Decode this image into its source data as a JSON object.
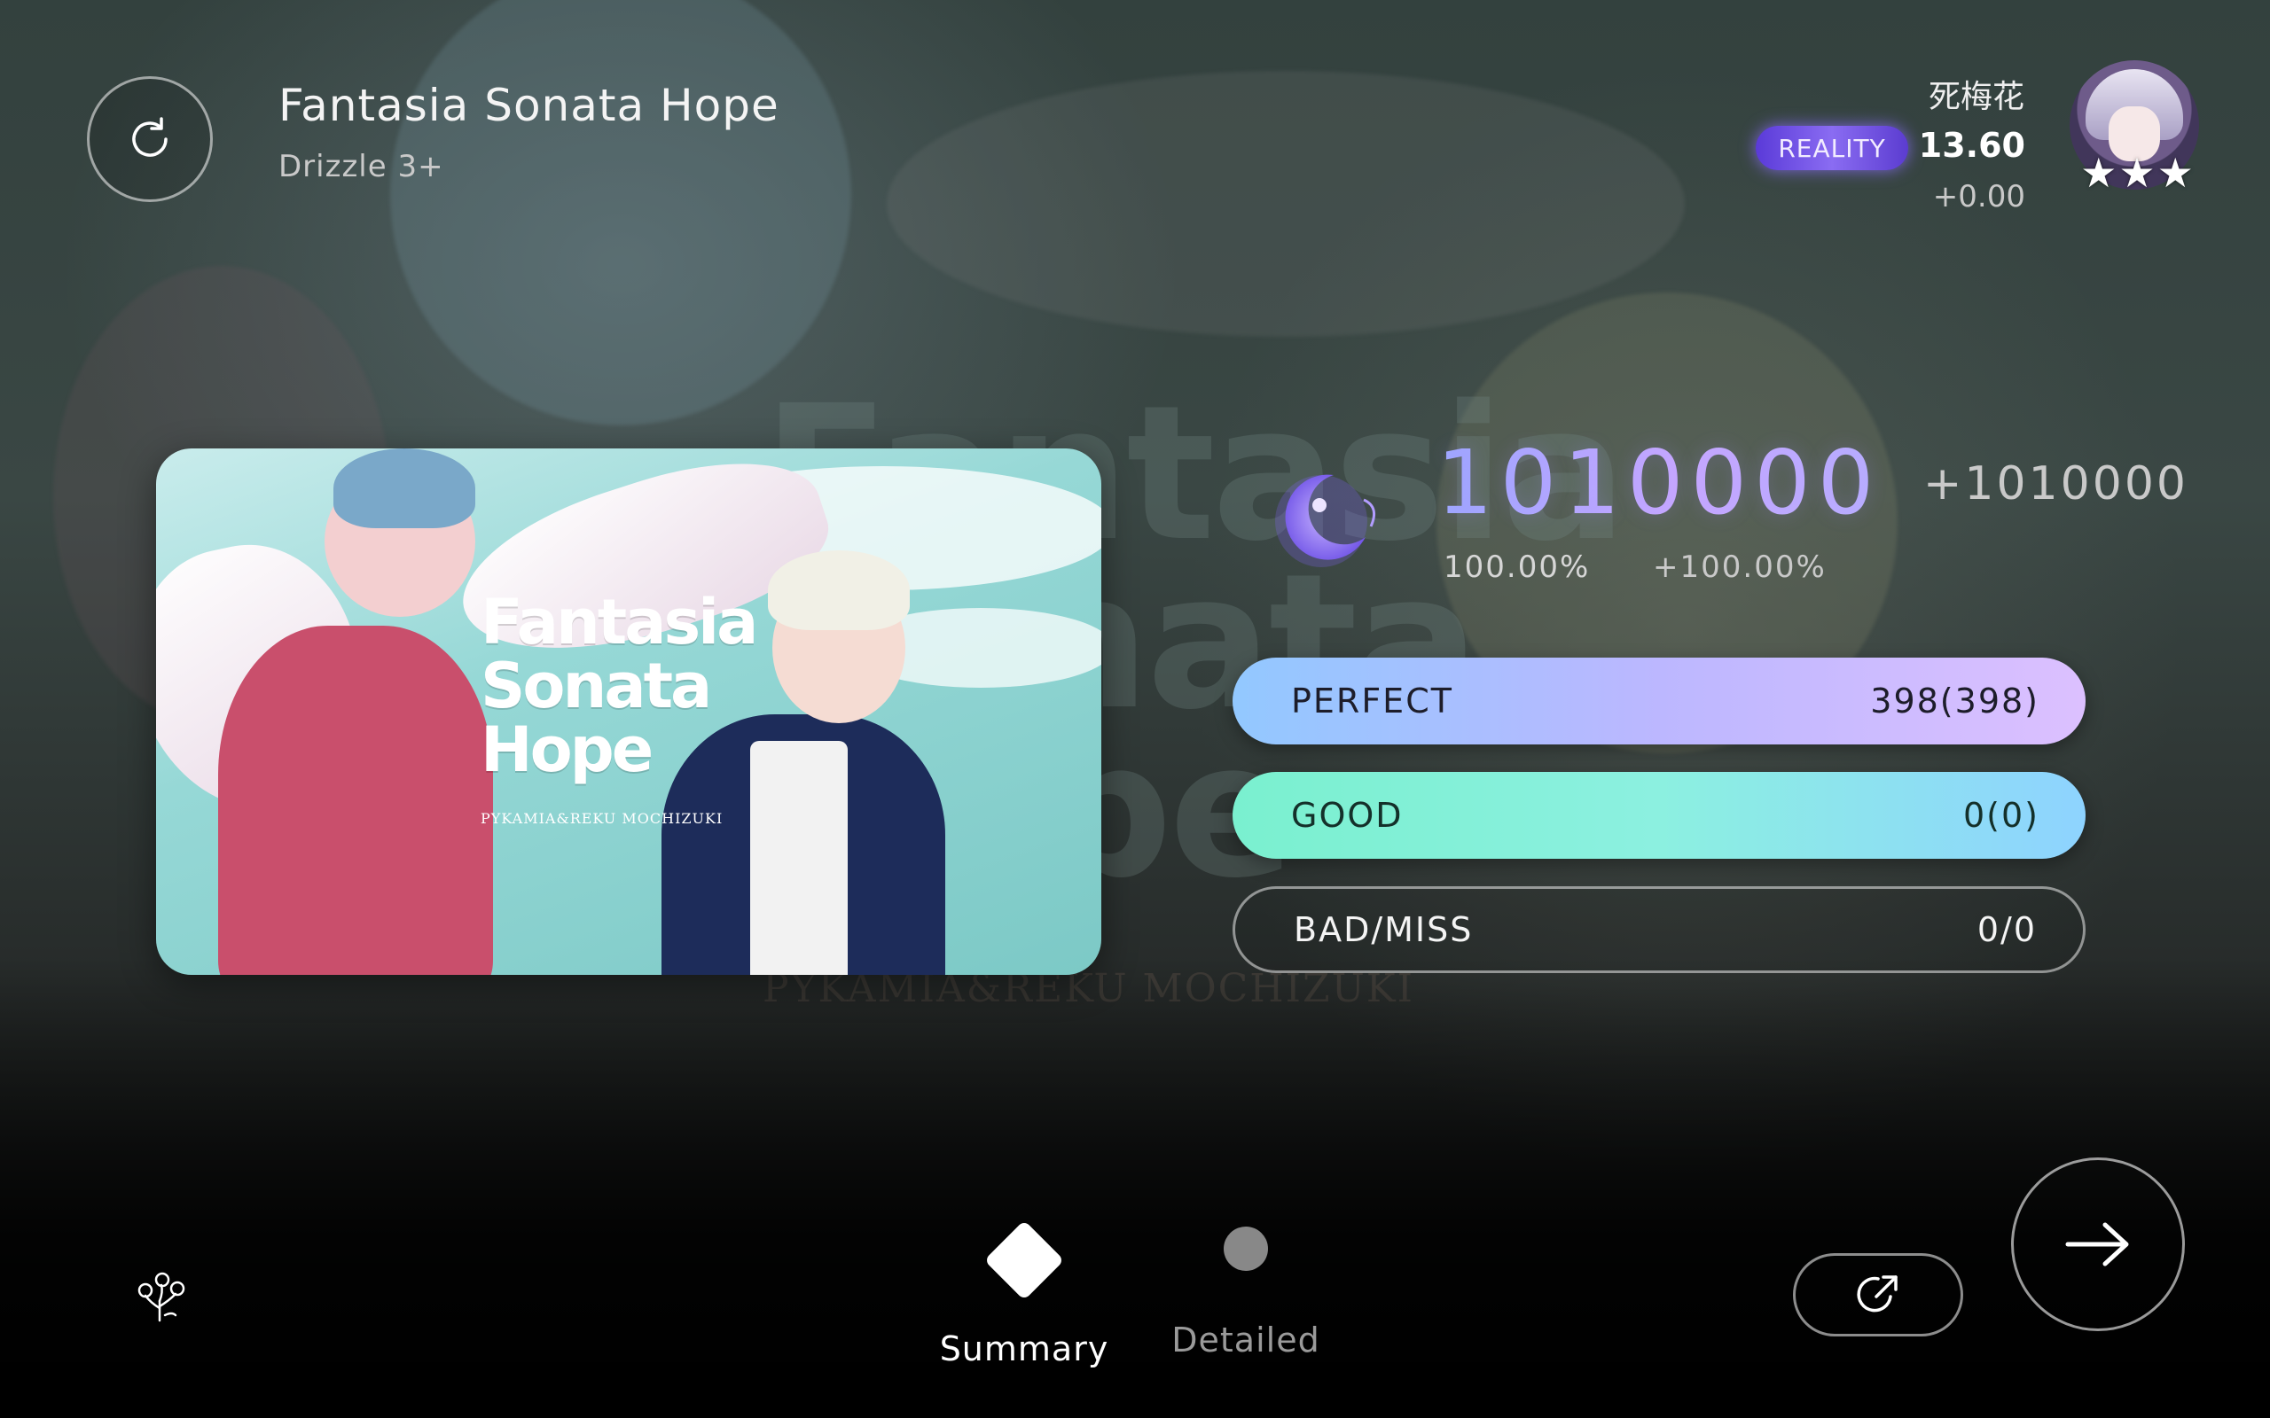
{
  "header": {
    "song_title": "Fantasia Sonata Hope",
    "difficulty": "Drizzle 3+"
  },
  "player": {
    "name": "死梅花",
    "badge": "REALITY",
    "rating": "13.60",
    "rating_delta": "+0.00",
    "stars": 3
  },
  "jacket": {
    "title_lines": [
      "Fantasia",
      "Sonata",
      "Hope"
    ],
    "credit": "PYKAMIA&REKU MOCHIZUKI"
  },
  "result": {
    "score": "1010000",
    "score_delta": "+1010000",
    "accuracy": "100.00%",
    "accuracy_delta": "+100.00%"
  },
  "judgements": {
    "perfect": {
      "label": "PERFECT",
      "value": "398(398)"
    },
    "good": {
      "label": "GOOD",
      "value": "0(0)"
    },
    "bad_miss": {
      "label": "BAD/MISS",
      "value": "0/0"
    }
  },
  "tabs": {
    "summary": "Summary",
    "detailed": "Detailed"
  },
  "colors": {
    "perfect_gradient": [
      "#92c8ff",
      "#dcc0ff"
    ],
    "good_gradient": [
      "#7af0cf",
      "#8ed3ff"
    ],
    "reality_badge": "#7a5cf0",
    "score_gradient": [
      "#9ea8ff",
      "#c9a9ff"
    ]
  },
  "icons": {
    "retry": "retry-icon",
    "moon": "moon-rank-icon",
    "flower": "flower-icon",
    "share": "share-icon",
    "next": "arrow-right-icon"
  }
}
